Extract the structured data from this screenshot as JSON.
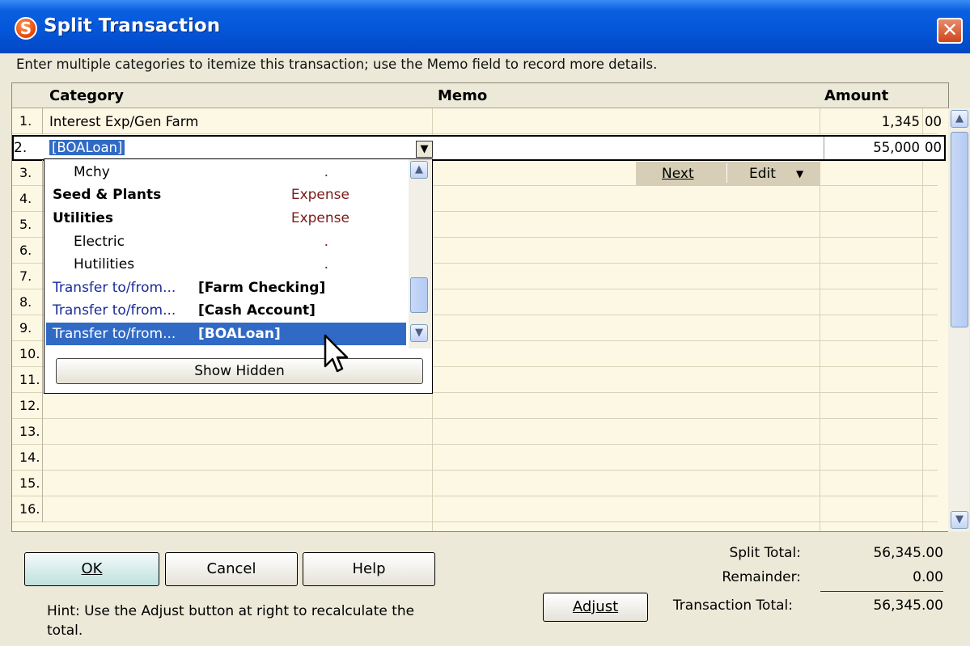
{
  "window": {
    "title": "Split Transaction",
    "close_icon": "close-icon",
    "app_icon": "S"
  },
  "instructions": "Enter multiple categories to itemize this transaction; use the Memo field to record more details.",
  "columns": {
    "category": "Category",
    "memo": "Memo",
    "amount": "Amount"
  },
  "rows": [
    {
      "num": "1.",
      "category": "Interest Exp/Gen Farm",
      "memo": "",
      "amount": "1,345",
      "cents": "00"
    },
    {
      "num": "2.",
      "category": "[BOALoan]",
      "memo": "",
      "amount": "55,000",
      "cents": "00"
    },
    {
      "num": "3."
    },
    {
      "num": "4."
    },
    {
      "num": "5."
    },
    {
      "num": "6."
    },
    {
      "num": "7."
    },
    {
      "num": "8."
    },
    {
      "num": "9."
    },
    {
      "num": "10."
    },
    {
      "num": "11."
    },
    {
      "num": "12."
    },
    {
      "num": "13."
    },
    {
      "num": "14."
    },
    {
      "num": "15."
    },
    {
      "num": "16."
    }
  ],
  "row_actions": {
    "next": "Next",
    "edit": "Edit"
  },
  "dropdown": {
    "items": [
      {
        "label": "Mchy",
        "type": ".",
        "style": "indent"
      },
      {
        "label": "Seed & Plants",
        "type": "Expense",
        "style": "bold"
      },
      {
        "label": "Utilities",
        "type": "Expense",
        "style": "bold"
      },
      {
        "label": "Electric",
        "type": ".",
        "style": "indent"
      },
      {
        "label": "Hutilities",
        "type": ".",
        "style": "indent"
      },
      {
        "label": "Transfer to/from...",
        "account": "[Farm Checking]",
        "style": "transfer"
      },
      {
        "label": "Transfer to/from...",
        "account": "[Cash Account]",
        "style": "transfer"
      },
      {
        "label": "Transfer to/from...",
        "account": "[BOALoan]",
        "style": "transfer",
        "selected": true
      }
    ],
    "show_hidden": "Show Hidden"
  },
  "buttons": {
    "ok": "OK",
    "cancel": "Cancel",
    "help": "Help",
    "adjust": "Adjust"
  },
  "totals": {
    "split_total_label": "Split Total:",
    "split_total": "56,345.00",
    "remainder_label": "Remainder:",
    "remainder": "0.00",
    "transaction_total_label": "Transaction Total:",
    "transaction_total": "56,345.00"
  },
  "hint": "Hint: Use the Adjust button at right to recalculate the total.",
  "colors": {
    "title_bar": "#0455d8",
    "grid_bg": "#fdf8e4",
    "selection": "#316ac5",
    "expense": "#7a1a1a",
    "transfer": "#1a2a9a"
  }
}
